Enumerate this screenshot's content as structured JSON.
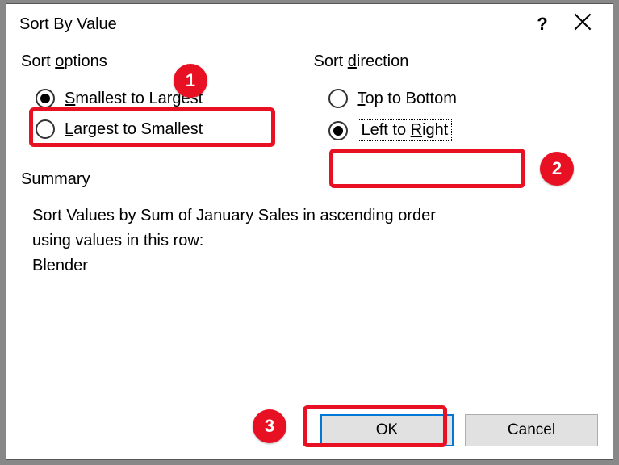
{
  "dialog": {
    "title": "Sort By Value"
  },
  "sortOptions": {
    "label_prefix": "Sort ",
    "label_u": "o",
    "label_suffix": "ptions",
    "opt1_u": "S",
    "opt1_rest": "mallest to Largest",
    "opt2_u": "L",
    "opt2_rest": "argest to Smallest"
  },
  "sortDirection": {
    "label_prefix": "Sort ",
    "label_u": "d",
    "label_suffix": "irection",
    "opt1_u": "T",
    "opt1_rest": "op to Bottom",
    "opt2_prefix": "Left to ",
    "opt2_u": "R",
    "opt2_suffix": "ight"
  },
  "summary": {
    "label": "Summary",
    "line1": "Sort Values by Sum of January Sales in ascending order",
    "line2": "using values in this row:",
    "line3": "Blender"
  },
  "buttons": {
    "ok": "OK",
    "cancel": "Cancel"
  },
  "callouts": {
    "c1": "1",
    "c2": "2",
    "c3": "3"
  }
}
